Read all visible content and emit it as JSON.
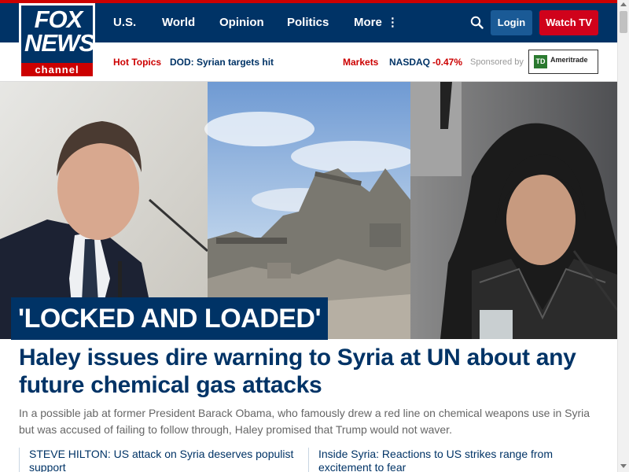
{
  "brand": {
    "logo_top": "FOX",
    "logo_middle": "NEWS",
    "logo_bottom": "channel"
  },
  "nav": {
    "items": [
      {
        "label": "U.S."
      },
      {
        "label": "World"
      },
      {
        "label": "Opinion"
      },
      {
        "label": "Politics"
      },
      {
        "label": "More"
      }
    ],
    "more_icon": "vertical-dots-icon",
    "login_label": "Login",
    "watch_label": "Watch TV"
  },
  "subnav": {
    "hot_topics_label": "Hot Topics",
    "hot_topic": "DOD: Syrian targets hit",
    "markets_label": "Markets",
    "index_name": "NASDAQ",
    "index_change": "-0.47%",
    "sponsored_label": "Sponsored by",
    "sponsor_mark": "TD",
    "sponsor_name": "Ameritrade"
  },
  "hero": {
    "label": "'LOCKED AND LOADED'"
  },
  "article": {
    "headline": "Haley issues dire warning to Syria at UN about any future chemical gas attacks",
    "summary": "In a possible jab at former President Barack Obama, who famously drew a red line on chemical weapons use in Syria but was accused of failing to follow through, Haley promised that Trump would not waver."
  },
  "related": [
    {
      "title": "STEVE HILTON: US attack on Syria deserves populist support"
    },
    {
      "title": "Inside Syria: Reactions to US strikes range from excitement to fear"
    }
  ],
  "colors": {
    "navy": "#003366",
    "red": "#c00000",
    "login_blue": "#1a5a96",
    "watch_red": "#d0021b"
  }
}
